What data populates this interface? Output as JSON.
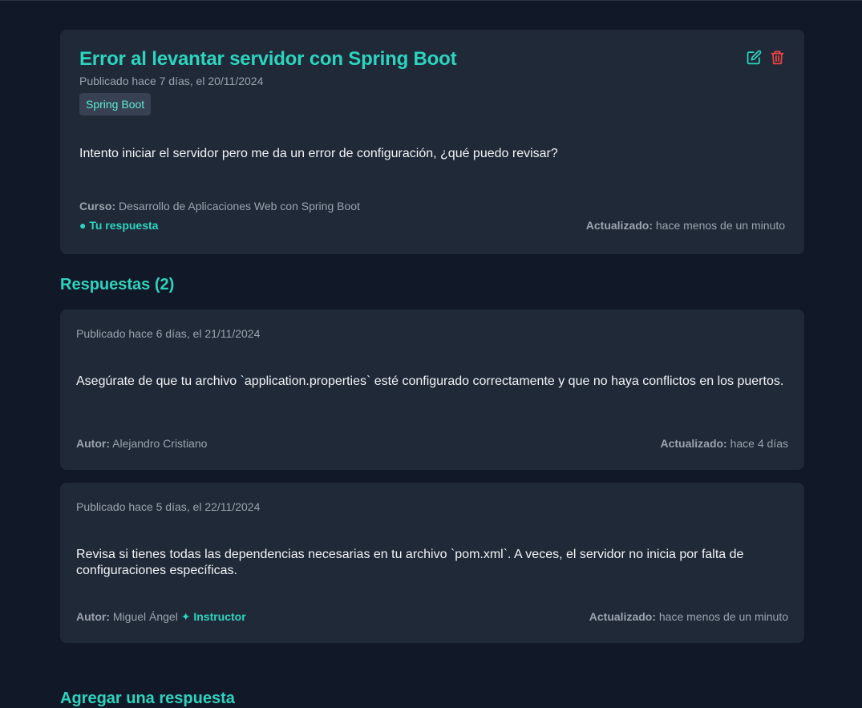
{
  "topic": {
    "title": "Error al levantar servidor con Spring Boot",
    "published": "Publicado hace 7 días, el 20/11/2024",
    "tag": "Spring Boot",
    "body": "Intento iniciar el servidor pero me da un error de configuración, ¿qué puedo revisar?",
    "course_label": "Curso:",
    "course_value": "Desarrollo de Aplicaciones Web con Spring Boot",
    "own_answer": "● Tu respuesta",
    "updated_label": "Actualizado:",
    "updated_value": "hace menos de un minuto",
    "edit_icon": "edit-icon",
    "delete_icon": "trash-icon",
    "edit_color": "#2dd4bf",
    "delete_color": "#ef4444"
  },
  "answers_section": {
    "title": "Respuestas (2)"
  },
  "answers": [
    {
      "published": "Publicado hace 6 días, el 21/11/2024",
      "body": "Asegúrate de que tu archivo `application.properties` esté configurado correctamente y que no haya conflictos en los puertos.",
      "author_label": "Autor:",
      "author": "Alejandro Cristiano",
      "badge": "",
      "updated_label": "Actualizado:",
      "updated_value": "hace 4 días"
    },
    {
      "published": "Publicado hace 5 días, el 22/11/2024",
      "body": "Revisa si tienes todas las dependencias necesarias en tu archivo `pom.xml`. A veces, el servidor no inicia por falta de configuraciones específicas.",
      "author_label": "Autor:",
      "author": "Miguel Ángel",
      "badge": "✦ Instructor",
      "updated_label": "Actualizado:",
      "updated_value": "hace menos de un minuto"
    }
  ],
  "add_answer": {
    "title": "Agregar una respuesta"
  },
  "colors": {
    "background": "#111827",
    "card": "#1f2937",
    "accent": "#2dd4bf",
    "danger": "#ef4444",
    "muted": "#9ca3af"
  }
}
